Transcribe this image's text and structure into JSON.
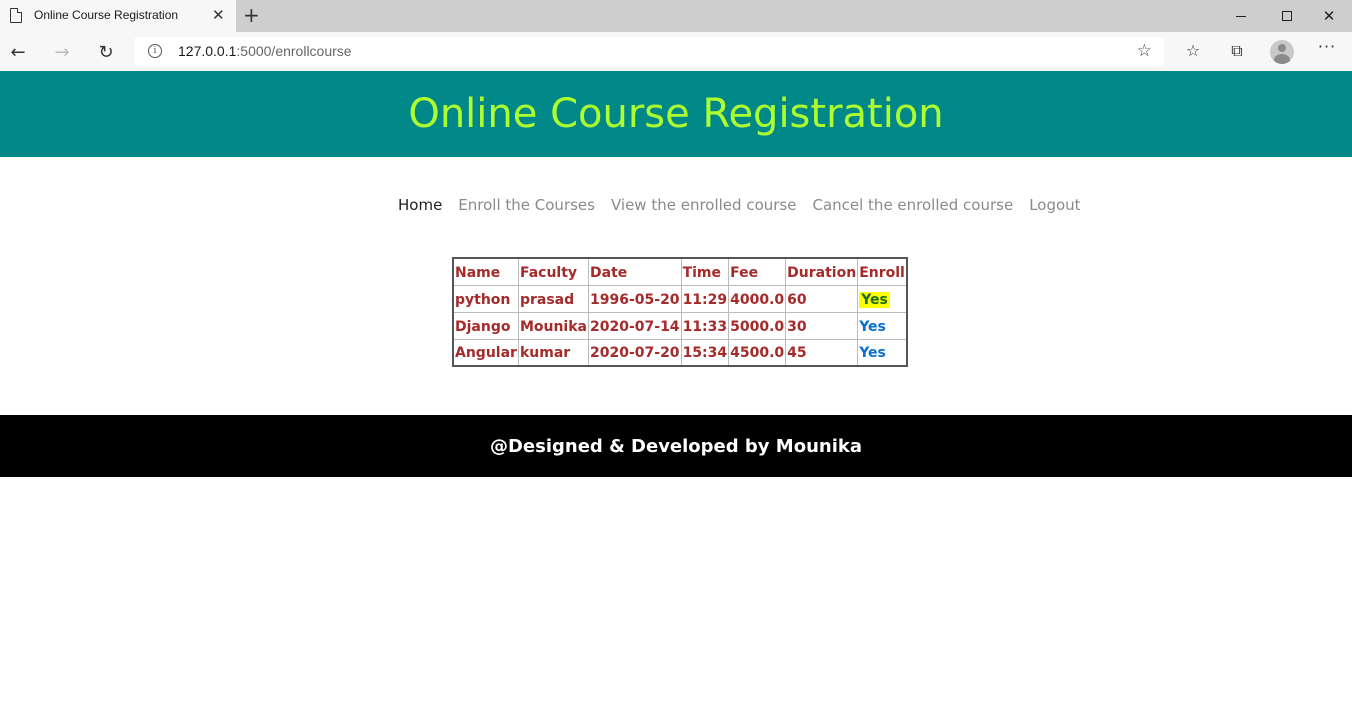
{
  "browser": {
    "tab_title": "Online Course Registration",
    "url_host": "127.0.0.1",
    "url_rest": ":5000/enrollcourse"
  },
  "header": {
    "title": "Online Course Registration"
  },
  "nav": {
    "items": [
      {
        "label": "Home"
      },
      {
        "label": "Enroll the Courses"
      },
      {
        "label": "View the enrolled course"
      },
      {
        "label": "Cancel the enrolled course"
      },
      {
        "label": "Logout"
      }
    ]
  },
  "table": {
    "headers": [
      "Name",
      "Faculty",
      "Date",
      "Time",
      "Fee",
      "Duration",
      "Enroll"
    ],
    "rows": [
      {
        "name": "python",
        "faculty": "prasad",
        "date": "1996-05-20",
        "time": "11:29",
        "fee": "4000.0",
        "duration": "60",
        "enroll": "Yes"
      },
      {
        "name": "Django",
        "faculty": "Mounika",
        "date": "2020-07-14",
        "time": "11:33",
        "fee": "5000.0",
        "duration": "30",
        "enroll": "Yes"
      },
      {
        "name": "Angular",
        "faculty": "kumar",
        "date": "2020-07-20",
        "time": "15:34",
        "fee": "4500.0",
        "duration": "45",
        "enroll": "Yes"
      }
    ]
  },
  "footer": {
    "text": "@Designed & Developed by Mounika"
  },
  "colors": {
    "header_bg": "#008888",
    "header_text": "#adff2f",
    "table_text": "#a52a2a",
    "link": "#0a6ecf",
    "footer_bg": "#000000"
  }
}
